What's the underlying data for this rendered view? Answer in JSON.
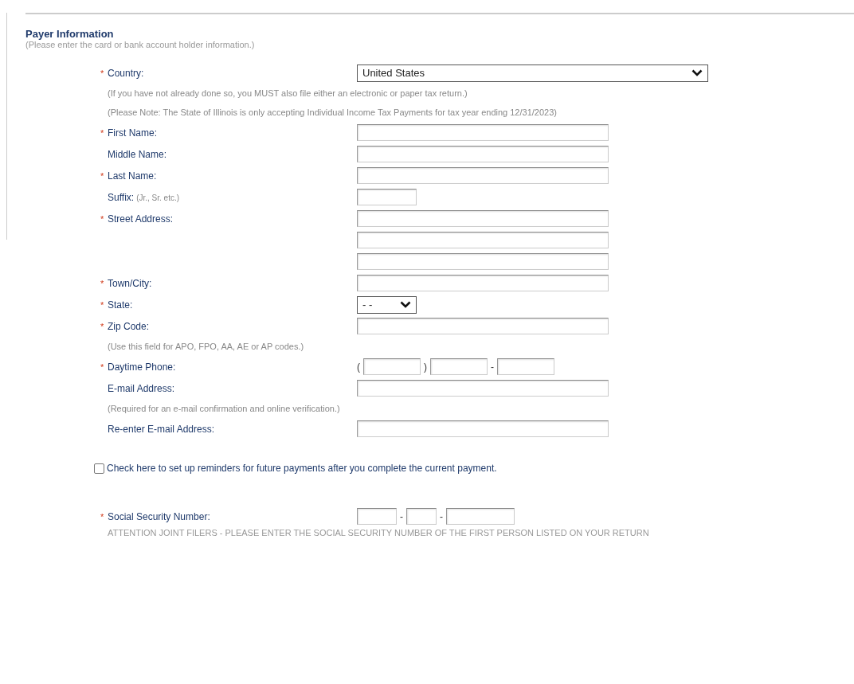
{
  "section": {
    "title": "Payer Information",
    "subtitle": "(Please enter the card or bank account holder information.)"
  },
  "rows": [
    {
      "kind": "dropdown",
      "required_mark": "*",
      "label": "Country:",
      "value": "United States"
    },
    {
      "kind": "note",
      "text": "(If you have not already done so, you MUST also file either an electronic or paper tax return.)"
    },
    {
      "kind": "note",
      "text": "(Please Note: The State of Illinois is only accepting Individual Income Tax Payments for tax year ending 12/31/2023)"
    },
    {
      "kind": "textbox",
      "required_mark": "*",
      "label": "First Name:"
    },
    {
      "kind": "textbox",
      "label": "Middle Name:"
    },
    {
      "kind": "textbox",
      "required_mark": "*",
      "label": "Last Name:"
    },
    {
      "kind": "smallbox",
      "label": "Suffix:",
      "hint": "(Jr., Sr. etc.)"
    },
    {
      "kind": "textbox",
      "required_mark": "*",
      "label": "Street Address:"
    },
    {
      "kind": "textbox"
    },
    {
      "kind": "textbox"
    },
    {
      "kind": "textbox",
      "required_mark": "*",
      "label": "Town/City:"
    },
    {
      "kind": "smalldropdown",
      "required_mark": "*",
      "label": "State:",
      "value": "- -"
    },
    {
      "kind": "textbox",
      "required_mark": "*",
      "label": "Zip Code:"
    },
    {
      "kind": "note",
      "text": "(Use this field for APO, FPO, AA, AE or AP codes.)"
    },
    {
      "kind": "phone",
      "required_mark": "*",
      "label": "Daytime Phone:",
      "open": "(",
      "close": ")",
      "dash": "-"
    },
    {
      "kind": "textbox",
      "label": "E-mail Address:"
    },
    {
      "kind": "note",
      "text": "(Required for an e-mail confirmation and online verification.)"
    },
    {
      "kind": "textbox",
      "label": "Re-enter E-mail Address:"
    }
  ],
  "reminder": {
    "label": "Check here to set up reminders for future payments after you complete the current payment.",
    "checked": false
  },
  "ssn": {
    "required_mark": "*",
    "label": "Social Security Number:",
    "separators": [
      "-",
      "-"
    ],
    "attention": "ATTENTION JOINT FILERS - PLEASE ENTER THE SOCIAL SECURITY NUMBER OF THE FIRST PERSON LISTED ON YOUR RETURN"
  }
}
